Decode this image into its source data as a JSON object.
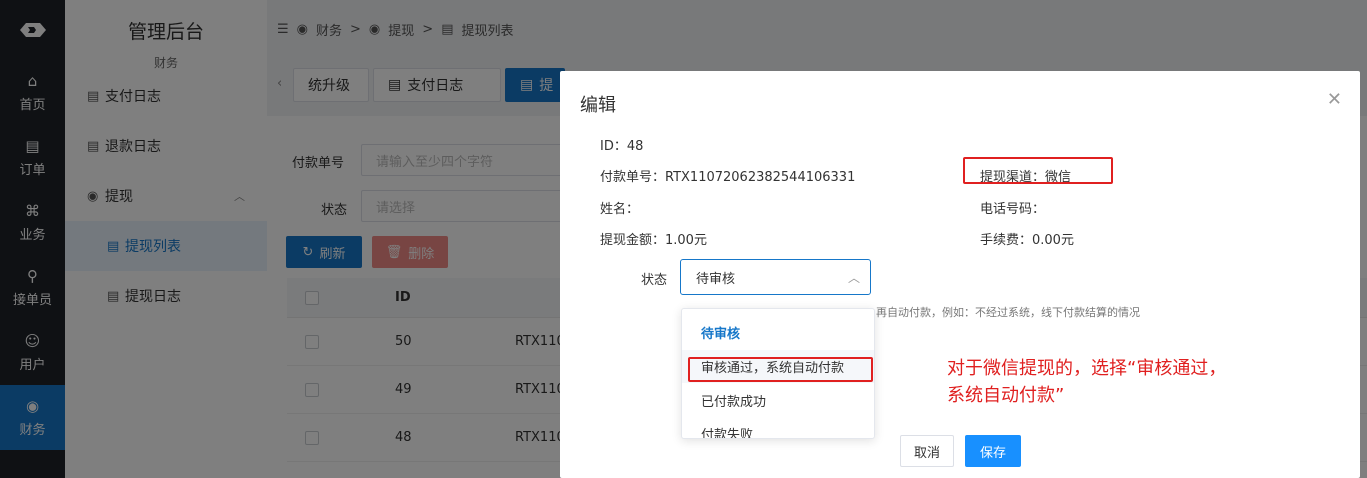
{
  "nav": {
    "items": [
      {
        "label": "首页",
        "icon": "home-icon"
      },
      {
        "label": "订单",
        "icon": "order-icon"
      },
      {
        "label": "业务",
        "icon": "business-icon"
      },
      {
        "label": "接单员",
        "icon": "bike-icon"
      },
      {
        "label": "用户",
        "icon": "user-icon"
      },
      {
        "label": "财务",
        "icon": "finance-icon",
        "active": true
      }
    ]
  },
  "sidebar": {
    "title": "管理后台",
    "subtitle": "财务",
    "items": [
      {
        "label": "支付日志"
      },
      {
        "label": "退款日志"
      },
      {
        "label": "提现",
        "expanded": true
      },
      {
        "label": "提现列表",
        "active": true
      },
      {
        "label": "提现日志"
      }
    ]
  },
  "breadcrumb": {
    "items": [
      "财务",
      "提现",
      "提现列表"
    ]
  },
  "tabs": {
    "items": [
      "统升级",
      "支付日志",
      "提"
    ]
  },
  "filters": {
    "pay_no_label": "付款单号",
    "pay_no_placeholder": "请输入至少四个字符",
    "status_label": "状态",
    "status_placeholder": "请选择"
  },
  "toolbar": {
    "refresh": "刷新",
    "delete": "删除"
  },
  "table": {
    "id_header": "ID",
    "rows": [
      {
        "id": "50",
        "no": "RTX110"
      },
      {
        "id": "49",
        "no": "RTX110"
      },
      {
        "id": "48",
        "no": "RTX110"
      }
    ]
  },
  "modal": {
    "title": "编辑",
    "id_line": "ID：48",
    "pay_no": "付款单号：RTX1107206238254410633​1",
    "channel": "提现渠道：微信",
    "name": "姓名：",
    "phone": "电话号码：",
    "amount": "提现金额：1.00元",
    "fee": "手续费：0.00元",
    "status_label": "状态",
    "status_value": "待审核",
    "hint": "再自动付款，例如：不经过系统，线下付款结算的情况",
    "options": [
      "待审核",
      "审核通过，系统自动付款",
      "已付款成功",
      "付款失败"
    ],
    "cancel": "取消",
    "save": "保存"
  },
  "annotation": {
    "line1": "对于微信提现的，选择“审核通过，",
    "line2": "系统自动付款”"
  },
  "colors": {
    "primary": "#1677c9",
    "annotation_red": "#e02020",
    "nav_bg": "#1f2329"
  }
}
